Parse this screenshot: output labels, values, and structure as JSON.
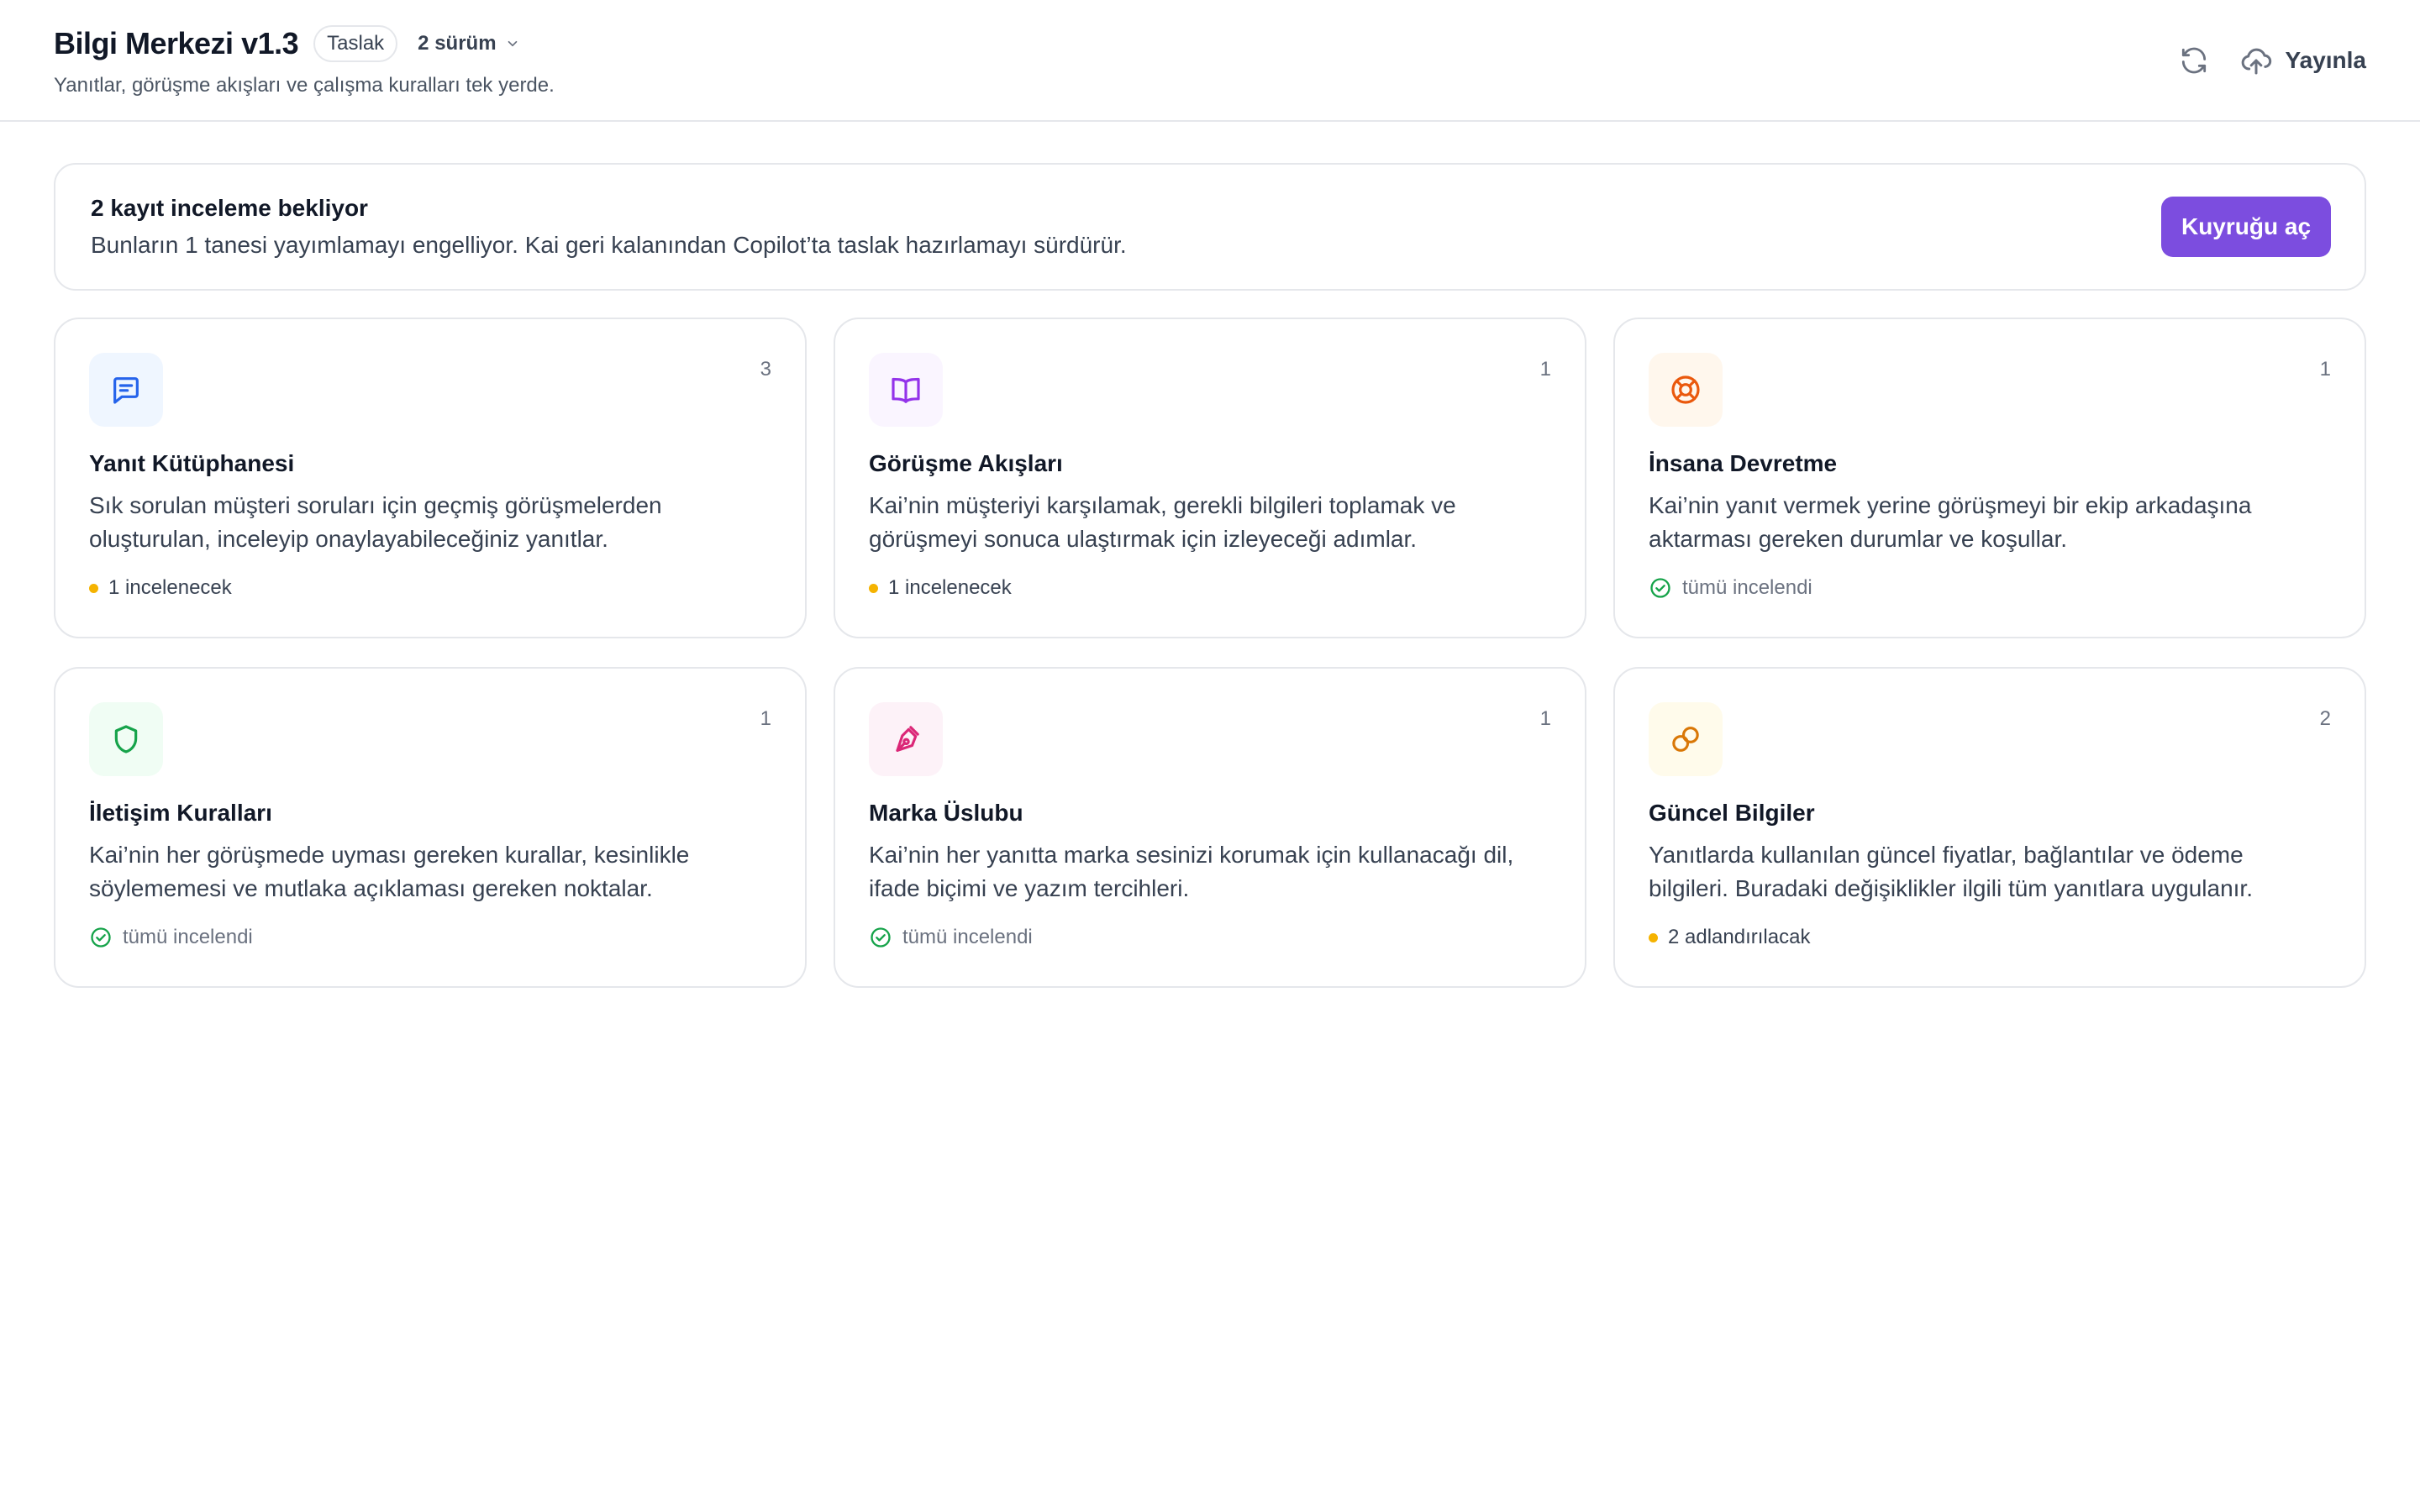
{
  "header": {
    "title": "Bilgi Merkezi v1.3",
    "badge": "Taslak",
    "versions_label": "2 sürüm",
    "subtitle": "Yanıtlar, görüşme akışları ve çalışma kuralları tek yerde.",
    "refresh_icon": "refresh-icon",
    "publish_label": "Yayınla",
    "publish_icon": "cloud-upload-icon"
  },
  "review": {
    "title": "2 kayıt inceleme bekliyor",
    "text": "Bunların 1 tanesi yayımlamayı engelliyor. Kai geri kalanından Copilot’ta taslak hazırlamayı sürdürür.",
    "button_label": "Kuyruğu aç",
    "button_color": "#7c4ddf"
  },
  "cards": [
    {
      "title": "Yanıt Kütüphanesi",
      "count": "3",
      "description": "Sık sorulan müşteri soruları için geçmiş görüşmelerden oluşturulan, inceleyip onaylayabileceğiniz yanıtlar.",
      "status": "1 incelenecek",
      "status_type": "pending",
      "icon": "chat-icon",
      "icon_color": "#2563eb",
      "icon_bg": "#eff6ff"
    },
    {
      "title": "Görüşme Akışları",
      "count": "1",
      "description": "Kai’nin müşteriyi karşılamak, gerekli bilgileri toplamak ve görüşmeyi sonuca ulaştırmak için izleyeceği adımlar.",
      "status": "1 incelenecek",
      "status_type": "pending",
      "icon": "book-icon",
      "icon_color": "#9333ea",
      "icon_bg": "#faf5ff"
    },
    {
      "title": "İnsana Devretme",
      "count": "1",
      "description": "Kai’nin yanıt vermek yerine görüşmeyi bir ekip arkadaşına aktarması gereken durumlar ve koşullar.",
      "status": "tümü incelendi",
      "status_type": "done",
      "icon": "lifebuoy-icon",
      "icon_color": "#ea580c",
      "icon_bg": "#fff7ed"
    },
    {
      "title": "İletişim Kuralları",
      "count": "1",
      "description": "Kai’nin her görüşmede uyması gereken kurallar, kesinlikle söylememesi ve mutlaka açıklaması gereken noktalar.",
      "status": "tümü incelendi",
      "status_type": "done",
      "icon": "shield-icon",
      "icon_color": "#16a34a",
      "icon_bg": "#f0fdf4"
    },
    {
      "title": "Marka Üslubu",
      "count": "1",
      "description": "Kai’nin her yanıtta marka sesinizi korumak için kullanacağı dil, ifade biçimi ve yazım tercihleri.",
      "status": "tümü incelendi",
      "status_type": "done",
      "icon": "pen-nib-icon",
      "icon_color": "#db2777",
      "icon_bg": "#fdf2f8"
    },
    {
      "title": "Güncel Bilgiler",
      "count": "2",
      "description": "Yanıtlarda kullanılan güncel fiyatlar, bağlantılar ve ödeme bilgileri. Buradaki değişiklikler ilgili tüm yanıtlara uygulanır.",
      "status": "2 adlandırılacak",
      "status_type": "pending",
      "icon": "variable-icon",
      "icon_color": "#d97706",
      "icon_bg": "#fffbeb"
    }
  ],
  "colors": {
    "pending_dot": "#f5b301",
    "done_check": "#16a34a"
  }
}
